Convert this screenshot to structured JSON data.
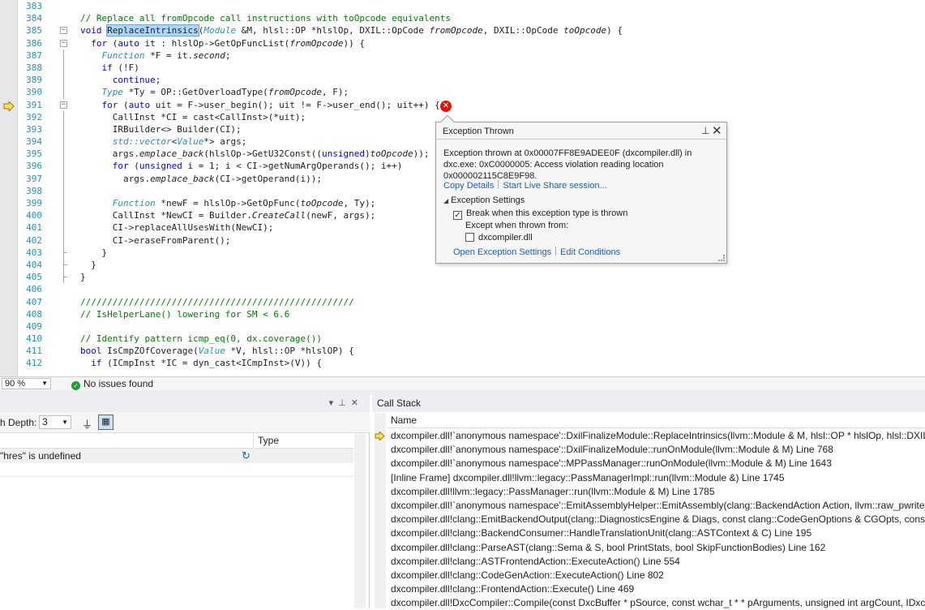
{
  "editor": {
    "lines": [
      {
        "n": "383",
        "html": ""
      },
      {
        "n": "384",
        "html": "<span class=\"cm\">// Replace all fromOpcode call instructions with toOpcode equivalents</span>"
      },
      {
        "n": "385",
        "html": "<span class=\"kw\">void</span> <span class=\"hl\">ReplaceIntrinsics</span>(<span class=\"ty it\">Module</span> &amp;M, hlsl::OP *hlslOp, DXIL::OpCode <span class=\"it\">fromOpcode</span>, DXIL::OpCode <span class=\"it\">toOpcode</span>) {"
      },
      {
        "n": "386",
        "html": "  <span class=\"kw\">for</span> (<span class=\"kw\">auto</span> it : hlslOp-&gt;GetOpFuncList(<span class=\"it\">fromOpcode</span>)) {"
      },
      {
        "n": "387",
        "html": "    <span class=\"ty it\">Function</span> *F = it.<span class=\"it\">second</span>;"
      },
      {
        "n": "388",
        "html": "    <span class=\"kw\">if</span> (!F)"
      },
      {
        "n": "389",
        "html": "      <span class=\"kw\">continue</span>;"
      },
      {
        "n": "390",
        "html": "    <span class=\"ty it\">Type</span> *Ty = OP::GetOverloadType(<span class=\"it\">fromOpcode</span>, F);"
      },
      {
        "n": "391",
        "html": "    <span class=\"kw\">for</span> (<span class=\"kw\">auto</span> uit = F-&gt;user_begin(); uit != F-&gt;user_end(); uit++) {"
      },
      {
        "n": "392",
        "html": "      CallInst *CI = cast&lt;CallInst&gt;(*uit);"
      },
      {
        "n": "393",
        "html": "      IRBuilder&lt;&gt; Builder(CI);"
      },
      {
        "n": "394",
        "html": "      <span class=\"ty it\">std::vector</span>&lt;<span class=\"ty it\">Value</span>*&gt; args;"
      },
      {
        "n": "395",
        "html": "      args.<span class=\"it\">emplace_back</span>(hlslOp-&gt;GetU32Const((<span class=\"kw\">unsigned</span>)<span class=\"it\">toOpcode</span>));"
      },
      {
        "n": "396",
        "html": "      <span class=\"kw\">for</span> (<span class=\"kw\">unsigned</span> i = 1; i &lt; CI-&gt;getNumArgOperands(); i++)"
      },
      {
        "n": "397",
        "html": "        args.<span class=\"it\">emplace_back</span>(CI-&gt;getOperand(i));"
      },
      {
        "n": "398",
        "html": ""
      },
      {
        "n": "399",
        "html": "      <span class=\"ty it\">Function</span> *newF = hlslOp-&gt;GetOpFunc(<span class=\"it\">toOpcode</span>, Ty);"
      },
      {
        "n": "400",
        "html": "      CallInst *NewCI = Builder.<span class=\"it\">CreateCall</span>(newF, args);"
      },
      {
        "n": "401",
        "html": "      CI-&gt;replaceAllUsesWith(NewCI);"
      },
      {
        "n": "402",
        "html": "      CI-&gt;eraseFromParent();"
      },
      {
        "n": "403",
        "html": "    }"
      },
      {
        "n": "404",
        "html": "  }"
      },
      {
        "n": "405",
        "html": "}"
      },
      {
        "n": "406",
        "html": ""
      },
      {
        "n": "407",
        "html": "<span class=\"cm\">///////////////////////////////////////////////////</span>"
      },
      {
        "n": "408",
        "html": "<span class=\"cm\">// IsHelperLane() lowering for SM &lt; 6.6</span>"
      },
      {
        "n": "409",
        "html": ""
      },
      {
        "n": "410",
        "html": "<span class=\"cm\">// Identify pattern icmp_eq(0, dx.coverage())</span>"
      },
      {
        "n": "411",
        "html": "<span class=\"kw\">bool</span> IsCmpZOfCoverage(<span class=\"ty it\">Value</span> *V, hlsl::OP *hlslOP) {"
      },
      {
        "n": "412",
        "html": "  <span class=\"kw\">if</span> (ICmpInst *IC = dyn_cast&lt;ICmpInst&gt;(V)) {"
      }
    ]
  },
  "exception": {
    "title": "Exception Thrown",
    "message": "Exception thrown at 0x00007FF8E9ADEE0F (dxcompiler.dll) in dxc.exe: 0xC0000005: Access violation reading location 0x000002115C8E9F98.",
    "copy_details": "Copy Details",
    "live_share": "Start Live Share session...",
    "settings_header": "Exception Settings",
    "break_when": "Break when this exception type is thrown",
    "except_when": "Except when thrown from:",
    "dll": "dxcompiler.dll",
    "open_settings": "Open Exception Settings",
    "edit_conditions": "Edit Conditions"
  },
  "status": {
    "zoom": "90 %",
    "issues": "No issues found"
  },
  "watch": {
    "depth_label": "h Depth:",
    "depth_value": "3",
    "col_type": "Type",
    "row_text": "\"hres\" is undefined"
  },
  "callstack": {
    "title": "Call Stack",
    "col_name": "Name",
    "rows": [
      "dxcompiler.dll!`anonymous namespace'::DxilFinalizeModule::ReplaceIntrinsics(llvm::Module & M, hlsl::OP * hlslOp, hlsl::DXIL::",
      "dxcompiler.dll!`anonymous namespace'::DxilFinalizeModule::runOnModule(llvm::Module & M) Line 768",
      "dxcompiler.dll!`anonymous namespace'::MPPassManager::runOnModule(llvm::Module & M) Line 1643",
      "[Inline Frame] dxcompiler.dll!llvm::legacy::PassManagerImpl::run(llvm::Module &) Line 1745",
      "dxcompiler.dll!llvm::legacy::PassManager::run(llvm::Module & M) Line 1785",
      "dxcompiler.dll!`anonymous namespace'::EmitAssemblyHelper::EmitAssembly(clang::BackendAction Action, llvm::raw_pwrite_",
      "dxcompiler.dll!clang::EmitBackendOutput(clang::DiagnosticsEngine & Diags, const clang::CodeGenOptions & CGOpts, const",
      "dxcompiler.dll!clang::BackendConsumer::HandleTranslationUnit(clang::ASTContext & C) Line 195",
      "dxcompiler.dll!clang::ParseAST(clang::Sema & S, bool PrintStats, bool SkipFunctionBodies) Line 162",
      "dxcompiler.dll!clang::ASTFrontendAction::ExecuteAction() Line 554",
      "dxcompiler.dll!clang::CodeGenAction::ExecuteAction() Line 802",
      "dxcompiler.dll!clang::FrontendAction::Execute() Line 469",
      "dxcompiler.dll!DxcCompiler::Compile(const DxcBuffer * pSource, const wchar_t * * pArguments, unsigned int argCount, IDxc"
    ]
  }
}
